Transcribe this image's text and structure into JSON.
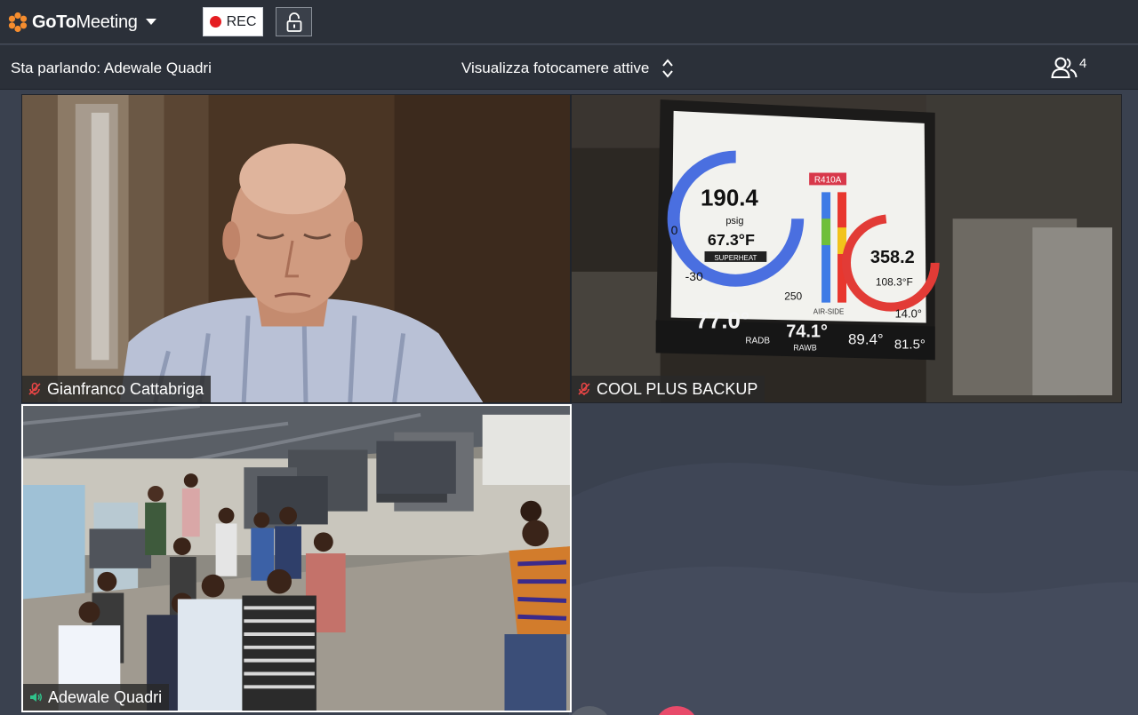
{
  "app": {
    "brand_bold": "GoTo",
    "brand_light": "Meeting",
    "accent_color": "#f68d2e"
  },
  "toolbar": {
    "rec_label": "REC",
    "rec_color": "#e51d22",
    "lock_icon": "unlock-icon"
  },
  "infobar": {
    "speaking_label": "Sta parlando: Adewale Quadri",
    "camera_view_label": "Visualizza fotocamere attive",
    "participants_count": "4"
  },
  "tiles": [
    {
      "name": "Gianfranco Cattabriga",
      "audio": "muted",
      "active": false
    },
    {
      "name": "COOL PLUS BACKUP",
      "audio": "muted",
      "active": false
    },
    {
      "name": "Adewale Quadri",
      "audio": "speaking",
      "active": true
    }
  ],
  "gauge_screen": {
    "pressure_left": "190.4",
    "pressure_unit": "psig",
    "temp_left": "67.3°F",
    "superheat_label": "SUPERHEAT",
    "refrigerant": "R410A",
    "pressure_right": "358.2",
    "temp_right": "108.3°F",
    "scale_zero": "0",
    "scale_neg": "-30",
    "scale_max": "250",
    "air_side_label": "AIR-SIDE",
    "air_side_value": "14.0°",
    "radb": "77.0°",
    "radb_label": "RADB",
    "rawb": "74.1°",
    "rawb_label": "RAWB",
    "v3": "89.4°",
    "v4": "81.5°"
  }
}
